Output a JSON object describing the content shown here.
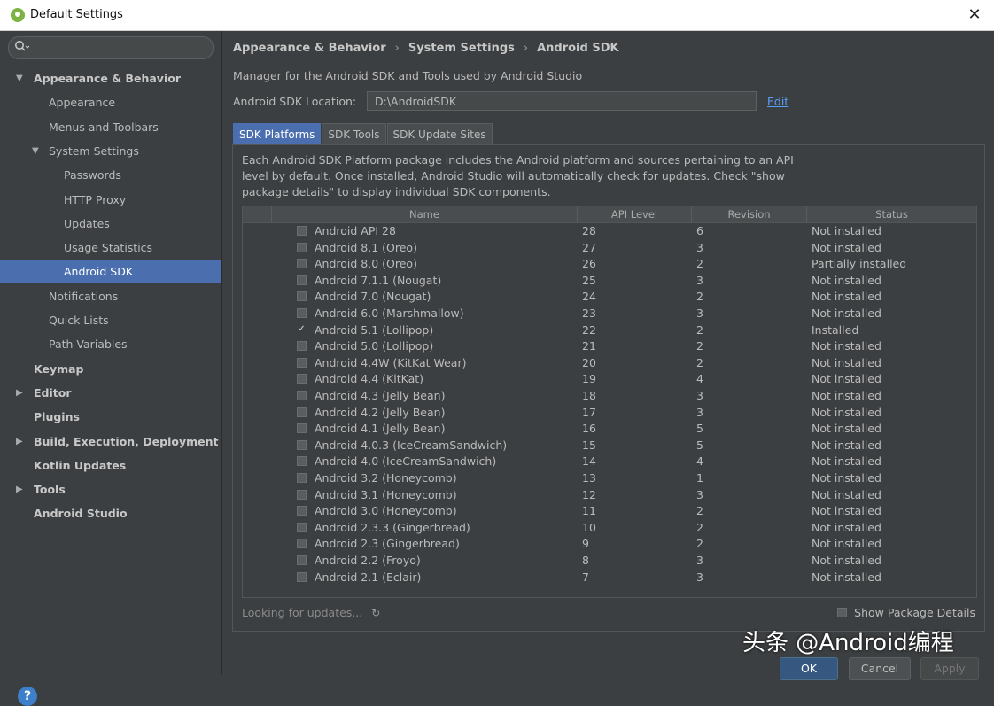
{
  "window": {
    "title": "Default Settings"
  },
  "sidebar": {
    "search_value": "",
    "items": [
      {
        "label": "Appearance & Behavior",
        "expanded": true,
        "bold": true
      },
      {
        "label": "Appearance"
      },
      {
        "label": "Menus and Toolbars"
      },
      {
        "label": "System Settings",
        "expanded": true
      },
      {
        "label": "Passwords"
      },
      {
        "label": "HTTP Proxy"
      },
      {
        "label": "Updates"
      },
      {
        "label": "Usage Statistics"
      },
      {
        "label": "Android SDK",
        "selected": true
      },
      {
        "label": "Notifications"
      },
      {
        "label": "Quick Lists"
      },
      {
        "label": "Path Variables"
      },
      {
        "label": "Keymap",
        "bold": true
      },
      {
        "label": "Editor",
        "bold": true,
        "collapsed": true
      },
      {
        "label": "Plugins",
        "bold": true
      },
      {
        "label": "Build, Execution, Deployment",
        "bold": true,
        "collapsed": true
      },
      {
        "label": "Kotlin Updates",
        "bold": true
      },
      {
        "label": "Tools",
        "bold": true,
        "collapsed": true
      },
      {
        "label": "Android Studio",
        "bold": true
      }
    ]
  },
  "main": {
    "breadcrumb": [
      "Appearance & Behavior",
      "System Settings",
      "Android SDK"
    ],
    "description": "Manager for the Android SDK and Tools used by Android Studio",
    "sdk_location_label": "Android SDK Location:",
    "sdk_location_value": "D:\\AndroidSDK",
    "edit_label": "Edit",
    "tabs": [
      "SDK Platforms",
      "SDK Tools",
      "SDK Update Sites"
    ],
    "panel_description": "Each Android SDK Platform package includes the Android platform and sources pertaining to an API level by default. Once installed, Android Studio will automatically check for updates. Check \"show package details\" to display individual SDK components.",
    "columns": [
      "Name",
      "API Level",
      "Revision",
      "Status"
    ],
    "rows": [
      {
        "name": "Android API 28",
        "api": "28",
        "revision": "6",
        "status": "Not installed",
        "checked": false
      },
      {
        "name": "Android 8.1 (Oreo)",
        "api": "27",
        "revision": "3",
        "status": "Not installed",
        "checked": false
      },
      {
        "name": "Android 8.0 (Oreo)",
        "api": "26",
        "revision": "2",
        "status": "Partially installed",
        "checked": false
      },
      {
        "name": "Android 7.1.1 (Nougat)",
        "api": "25",
        "revision": "3",
        "status": "Not installed",
        "checked": false
      },
      {
        "name": "Android 7.0 (Nougat)",
        "api": "24",
        "revision": "2",
        "status": "Not installed",
        "checked": false
      },
      {
        "name": "Android 6.0 (Marshmallow)",
        "api": "23",
        "revision": "3",
        "status": "Not installed",
        "checked": false
      },
      {
        "name": "Android 5.1 (Lollipop)",
        "api": "22",
        "revision": "2",
        "status": "Installed",
        "checked": true
      },
      {
        "name": "Android 5.0 (Lollipop)",
        "api": "21",
        "revision": "2",
        "status": "Not installed",
        "checked": false
      },
      {
        "name": "Android 4.4W (KitKat Wear)",
        "api": "20",
        "revision": "2",
        "status": "Not installed",
        "checked": false
      },
      {
        "name": "Android 4.4 (KitKat)",
        "api": "19",
        "revision": "4",
        "status": "Not installed",
        "checked": false
      },
      {
        "name": "Android 4.3 (Jelly Bean)",
        "api": "18",
        "revision": "3",
        "status": "Not installed",
        "checked": false
      },
      {
        "name": "Android 4.2 (Jelly Bean)",
        "api": "17",
        "revision": "3",
        "status": "Not installed",
        "checked": false
      },
      {
        "name": "Android 4.1 (Jelly Bean)",
        "api": "16",
        "revision": "5",
        "status": "Not installed",
        "checked": false
      },
      {
        "name": "Android 4.0.3 (IceCreamSandwich)",
        "api": "15",
        "revision": "5",
        "status": "Not installed",
        "checked": false
      },
      {
        "name": "Android 4.0 (IceCreamSandwich)",
        "api": "14",
        "revision": "4",
        "status": "Not installed",
        "checked": false
      },
      {
        "name": "Android 3.2 (Honeycomb)",
        "api": "13",
        "revision": "1",
        "status": "Not installed",
        "checked": false
      },
      {
        "name": "Android 3.1 (Honeycomb)",
        "api": "12",
        "revision": "3",
        "status": "Not installed",
        "checked": false
      },
      {
        "name": "Android 3.0 (Honeycomb)",
        "api": "11",
        "revision": "2",
        "status": "Not installed",
        "checked": false
      },
      {
        "name": "Android 2.3.3 (Gingerbread)",
        "api": "10",
        "revision": "2",
        "status": "Not installed",
        "checked": false
      },
      {
        "name": "Android 2.3 (Gingerbread)",
        "api": "9",
        "revision": "2",
        "status": "Not installed",
        "checked": false
      },
      {
        "name": "Android 2.2 (Froyo)",
        "api": "8",
        "revision": "3",
        "status": "Not installed",
        "checked": false
      },
      {
        "name": "Android 2.1 (Eclair)",
        "api": "7",
        "revision": "3",
        "status": "Not installed",
        "checked": false
      }
    ],
    "loading_text": "Looking for updates...",
    "show_details_label": "Show Package Details"
  },
  "buttons": {
    "ok": "OK",
    "cancel": "Cancel",
    "apply": "Apply"
  },
  "watermark": "头条 @Android编程",
  "colors": {
    "accent": "#4b6eaf",
    "background": "#3c3f41",
    "link": "#589df6"
  }
}
